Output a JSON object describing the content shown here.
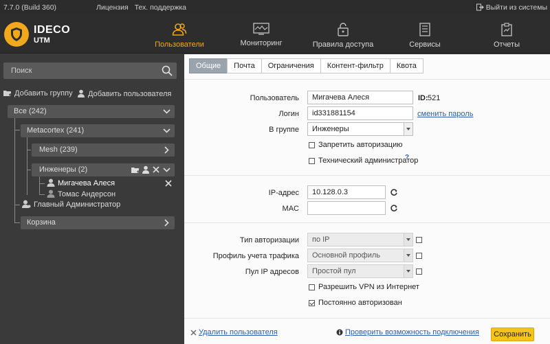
{
  "topbar": {
    "version": "7.7.0 (Build 360)",
    "license": "Лицензия",
    "support": "Тех. поддержка",
    "logout": "Выйти из системы"
  },
  "logo": {
    "line1": "IDECO",
    "line2": "UTM"
  },
  "nav": [
    {
      "label": "Пользователи",
      "icon": "users-icon",
      "active": true
    },
    {
      "label": "Мониторинг",
      "icon": "monitor-icon"
    },
    {
      "label": "Правила доступа",
      "icon": "lock-icon"
    },
    {
      "label": "Сервисы",
      "icon": "server-icon"
    },
    {
      "label": "Отчеты",
      "icon": "report-icon"
    }
  ],
  "colors": {
    "accent": "#f2a81c",
    "save": "#f7c21a",
    "link": "#2a5db0",
    "sidebar": "#3a3a3a"
  },
  "sidebar": {
    "search_placeholder": "Поиск",
    "add_group": "Добавить группу",
    "add_user": "Добавить пользователя",
    "tree": {
      "all": "Все (242)",
      "metacortex": "Metacortex (241)",
      "mesh": "Mesh (239)",
      "engineers": "Инженеры (2)",
      "user1": "Мигачева Алеся",
      "user2": "Томас Андерсон",
      "admin": "Главный Администратор",
      "trash": "Корзина"
    }
  },
  "tabs": [
    "Общие",
    "Почта",
    "Ограничения",
    "Контент-фильтр",
    "Квота"
  ],
  "form": {
    "user_label": "Пользователь",
    "user_value": "Мигачева Алеся",
    "id_label": "ID:",
    "id_value": "521",
    "login_label": "Логин",
    "login_value": "id331881154",
    "change_password": "сменить пароль",
    "group_label": "В группе",
    "group_value": "Инженеры",
    "deny_auth": "Запретить авторизацию",
    "tech_admin": "Технический администратор",
    "tech_admin_help": "?",
    "ip_label": "IP-адрес",
    "ip_value": "10.128.0.3",
    "mac_label": "MAC",
    "mac_value": "",
    "auth_type_label": "Тип авторизации",
    "auth_type_value": "по IP",
    "traffic_profile_label": "Профиль учета трафика",
    "traffic_profile_value": "Основной профиль",
    "ip_pool_label": "Пул IP адресов",
    "ip_pool_value": "Простой пул",
    "allow_vpn": "Разрешить VPN из Интернет",
    "always_auth": "Постоянно авторизован",
    "always_auth_checked": true
  },
  "footer": {
    "delete_user": "Удалить пользователя",
    "check_connection": "Проверить возможность подключения",
    "save": "Сохранить"
  }
}
